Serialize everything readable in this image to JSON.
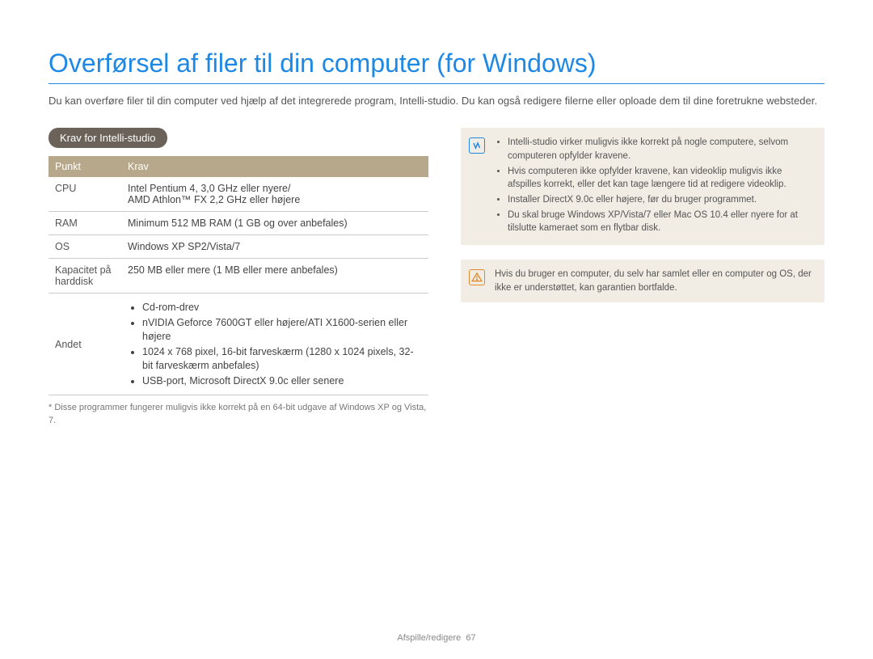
{
  "title": "Overførsel af filer til din computer (for Windows)",
  "intro": "Du kan overføre filer til din computer ved hjælp af det integrerede program, Intelli-studio. Du kan også redigere filerne eller oploade dem til dine foretrukne websteder.",
  "pill": "Krav for Intelli-studio",
  "table": {
    "headers": {
      "col1": "Punkt",
      "col2": "Krav"
    },
    "rows": {
      "cpu": {
        "label": "CPU",
        "value": "Intel Pentium 4, 3,0 GHz eller nyere/\nAMD Athlon™ FX 2,2 GHz eller højere"
      },
      "ram": {
        "label": "RAM",
        "value": "Minimum 512 MB RAM (1 GB og over anbefales)"
      },
      "os": {
        "label": "OS",
        "value": "Windows XP SP2/Vista/7"
      },
      "disk": {
        "label": "Kapacitet på harddisk",
        "value": "250 MB eller mere (1 MB eller mere anbefales)"
      },
      "other": {
        "label": "Andet",
        "bullets": [
          "Cd-rom-drev",
          "nVIDIA Geforce 7600GT eller højere/ATI X1600-serien eller højere",
          "1024 x 768 pixel, 16-bit farveskærm (1280 x 1024 pixels, 32-bit farveskærm anbefales)",
          "USB-port, Microsoft DirectX 9.0c eller senere"
        ]
      }
    }
  },
  "footnote": "* Disse programmer fungerer muligvis ikke korrekt på en 64-bit udgave af Windows XP og Vista, 7.",
  "info_note": {
    "bullets": [
      "Intelli-studio virker muligvis ikke korrekt på nogle computere, selvom computeren opfylder kravene.",
      "Hvis computeren ikke opfylder kravene, kan videoklip muligvis ikke afspilles korrekt, eller det kan tage længere tid at redigere videoklip.",
      "Installer DirectX 9.0c eller højere, før du bruger programmet.",
      "Du skal bruge Windows XP/Vista/7 eller Mac OS 10.4 eller nyere for at tilslutte kameraet som en flytbar disk."
    ]
  },
  "warn_note": "Hvis du bruger en computer, du selv har samlet eller en computer og OS, der ikke er understøttet, kan garantien bortfalde.",
  "footer": {
    "section": "Afspille/redigere",
    "page": "67"
  }
}
